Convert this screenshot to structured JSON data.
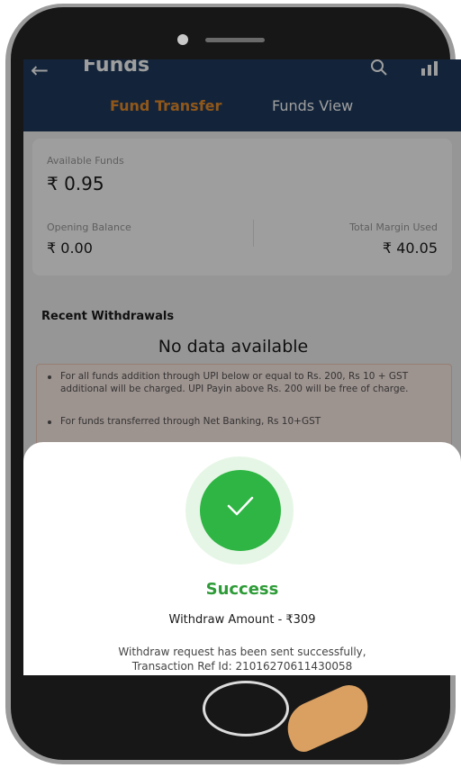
{
  "header": {
    "title": "Funds",
    "back_icon": "arrow-left-icon",
    "search_icon": "search-icon",
    "chart_icon": "chart-icon"
  },
  "tabs": [
    {
      "label": "Fund Transfer",
      "active": true
    },
    {
      "label": "Funds View",
      "active": false
    }
  ],
  "balances": {
    "available_label": "Available Funds",
    "available_value": "₹ 0.95",
    "opening_label": "Opening Balance",
    "opening_value": "₹ 0.00",
    "margin_label": "Total Margin Used",
    "margin_value": "₹ 40.05"
  },
  "withdrawals": {
    "title": "Recent Withdrawals",
    "empty_text": "No data available"
  },
  "notices": [
    "For all funds addition through UPI below or equal to Rs. 200, Rs 10 + GST additional will be charged. UPI Payin above Rs. 200 will be free of charge.",
    "For funds transferred through Net Banking, Rs 10+GST"
  ],
  "success_sheet": {
    "status": "Success",
    "amount": "Withdraw Amount - ₹309",
    "message_line1": "Withdraw request has been sent successfully,",
    "message_line2": "Transaction Ref Id: 21016270611430058"
  },
  "colors": {
    "header": "#1f3a5e",
    "active_tab": "#e88d2b",
    "success": "#2eb543",
    "success_text": "#2d9b37"
  }
}
